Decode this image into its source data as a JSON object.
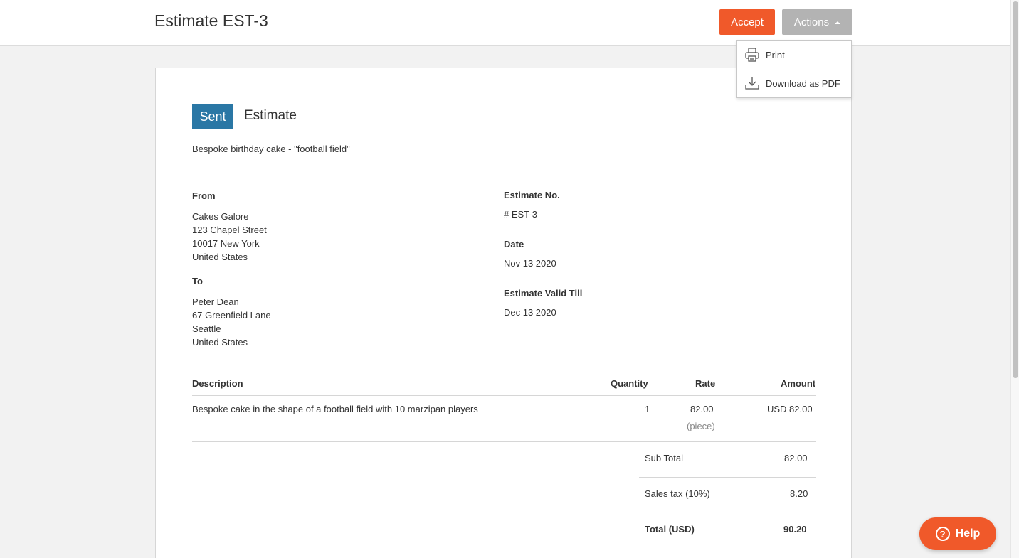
{
  "header": {
    "title": "Estimate EST-3",
    "accept_label": "Accept",
    "actions_label": "Actions"
  },
  "actions_menu": {
    "items": [
      {
        "label": "Print",
        "icon": "printer-icon"
      },
      {
        "label": "Download as PDF",
        "icon": "download-icon"
      }
    ]
  },
  "document": {
    "status_badge": "Sent",
    "type": "Estimate",
    "subject": "Bespoke birthday cake - \"football field\"",
    "from": {
      "label": "From",
      "lines": [
        "Cakes Galore",
        "123 Chapel Street",
        "10017 New York",
        "United States"
      ]
    },
    "to": {
      "label": "To",
      "lines": [
        "Peter Dean",
        "67 Greenfield Lane",
        "Seattle",
        "United States"
      ]
    },
    "estimate_no": {
      "label": "Estimate No.",
      "value": "# EST-3"
    },
    "date": {
      "label": "Date",
      "value": "Nov 13 2020"
    },
    "valid_till": {
      "label": "Estimate Valid Till",
      "value": "Dec 13 2020"
    },
    "table": {
      "headers": {
        "description": "Description",
        "quantity": "Quantity",
        "rate": "Rate",
        "amount": "Amount"
      },
      "rows": [
        {
          "description": "Bespoke cake in the shape of a football field with 10 marzipan players",
          "quantity": "1",
          "rate": "82.00",
          "unit": "(piece)",
          "amount": "USD 82.00"
        }
      ]
    },
    "totals": {
      "sub_total_label": "Sub Total",
      "sub_total_value": "82.00",
      "tax_label": "Sales tax (10%)",
      "tax_value": "8.20",
      "total_label": "Total (USD)",
      "total_value": "90.20"
    }
  },
  "help": {
    "label": "Help",
    "icon": "question-icon"
  },
  "colors": {
    "accent": "#f0592a",
    "badge": "#2a77a5",
    "actions_button": "#b3b3b3"
  }
}
